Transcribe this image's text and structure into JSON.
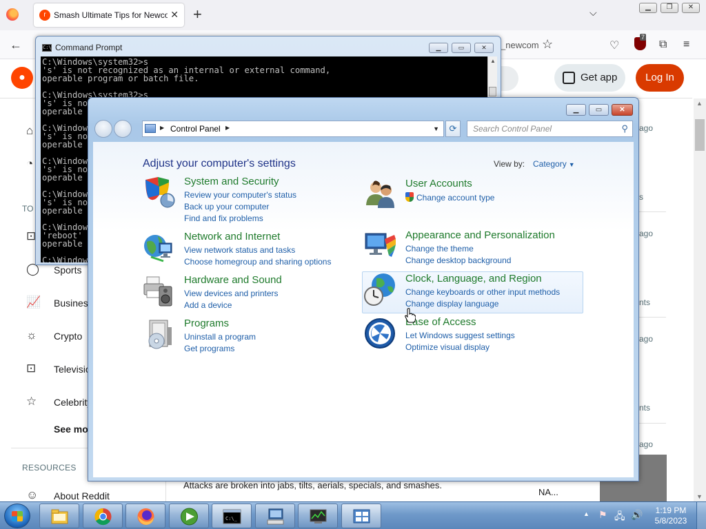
{
  "browser": {
    "tab_title": "Smash Ultimate Tips for Newcomers",
    "url_fragment": "_newcom",
    "ublock_badge": "7"
  },
  "reddit": {
    "get_app": "Get app",
    "log_in": "Log In",
    "sidebar_top_label": "TO",
    "sidebar": [
      "Sports",
      "Business",
      "Crypto",
      "Television",
      "Celebrity"
    ],
    "see_more": "See more",
    "resources": "RESOURCES",
    "about": "About Reddit",
    "feed_snippet": "Attacks are broken into jabs, tilts, aerials, specials, and smashes.",
    "right_na": "NA...",
    "right_frags": [
      "ago",
      "s",
      "ago",
      "nts",
      "ago",
      "nts",
      "ago"
    ]
  },
  "cmd": {
    "title": "Command Prompt",
    "lines": [
      "C:\\Windows\\system32>s",
      "'s' is not recognized as an internal or external command,",
      "operable program or batch file.",
      "",
      "C:\\Windows\\system32>s",
      "'s' is no",
      "operable",
      "",
      "C:\\Window",
      "'s' is no",
      "operable",
      "",
      "C:\\Window",
      "'s' is no",
      "operable",
      "",
      "C:\\Window",
      "'s' is no",
      "operable",
      "",
      "C:\\Window",
      "'reboot'",
      "operable",
      "",
      "C:\\Window"
    ]
  },
  "control_panel": {
    "address": "Control Panel",
    "search_placeholder": "Search Control Panel",
    "heading": "Adjust your computer's settings",
    "view_by_label": "View by:",
    "view_by_value": "Category",
    "categories": [
      {
        "title": "System and Security",
        "links": [
          "Review your computer's status",
          "Back up your computer",
          "Find and fix problems"
        ]
      },
      {
        "title": "Network and Internet",
        "links": [
          "View network status and tasks",
          "Choose homegroup and sharing options"
        ]
      },
      {
        "title": "Hardware and Sound",
        "links": [
          "View devices and printers",
          "Add a device"
        ]
      },
      {
        "title": "Programs",
        "links": [
          "Uninstall a program",
          "Get programs"
        ]
      },
      {
        "title": "User Accounts",
        "links": [
          "Change account type"
        ]
      },
      {
        "title": "Appearance and Personalization",
        "links": [
          "Change the theme",
          "Change desktop background"
        ]
      },
      {
        "title": "Clock, Language, and Region",
        "links": [
          "Change keyboards or other input methods",
          "Change display language"
        ]
      },
      {
        "title": "Ease of Access",
        "links": [
          "Let Windows suggest settings",
          "Optimize visual display"
        ]
      }
    ]
  },
  "taskbar": {
    "time": "1:19 PM",
    "date": "5/8/2023"
  }
}
